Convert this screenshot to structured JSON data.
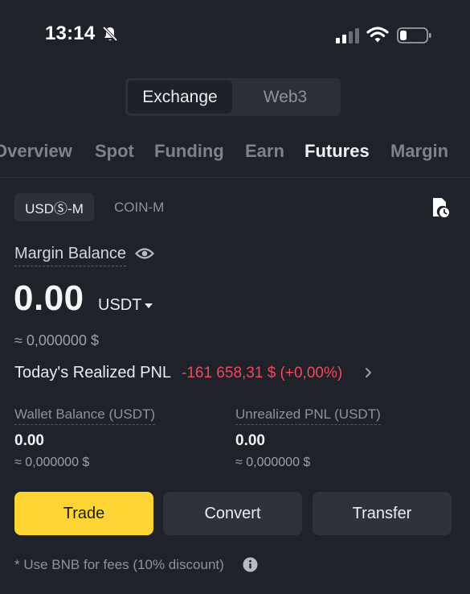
{
  "status_bar": {
    "time": "13:14"
  },
  "top_switch": {
    "options": [
      "Exchange",
      "Web3"
    ],
    "selected": "Exchange"
  },
  "tabs": {
    "items": [
      "Overview",
      "Spot",
      "Funding",
      "Earn",
      "Futures",
      "Margin"
    ],
    "active": "Futures"
  },
  "futures": {
    "usds_chip": "USDⓈ-M",
    "coin_chip": "COIN-M",
    "margin_balance_label": "Margin Balance",
    "margin_balance_value": "0.00",
    "margin_balance_unit": "USDT",
    "margin_balance_approx": "≈ 0,000000 $",
    "realized_pnl_label": "Today's Realized PNL",
    "realized_pnl_value": "-161 658,31 $ (+0,00%)",
    "wallet_balance_label": "Wallet Balance (USDT)",
    "wallet_balance_value": "0.00",
    "wallet_balance_approx": "≈ 0,000000 $",
    "unrealized_pnl_label": "Unrealized PNL (USDT)",
    "unrealized_pnl_value": "0.00",
    "unrealized_pnl_approx": "≈ 0,000000 $"
  },
  "actions": {
    "trade": "Trade",
    "convert": "Convert",
    "transfer": "Transfer"
  },
  "fee_note": "* Use BNB for fees (10% discount)",
  "colors": {
    "background": "#1f2229",
    "accent_yellow": "#fcd535",
    "negative_red": "#f0485e",
    "muted_text": "#8d929c"
  },
  "icons": {
    "bell": "bell-slash-icon",
    "signal": "cellular-signal-icon",
    "wifi": "wifi-icon",
    "battery": "battery-icon",
    "history": "order-history-icon",
    "eye": "eye-icon",
    "caret": "caret-down-icon",
    "chevron": "chevron-right-icon",
    "info": "info-icon"
  }
}
